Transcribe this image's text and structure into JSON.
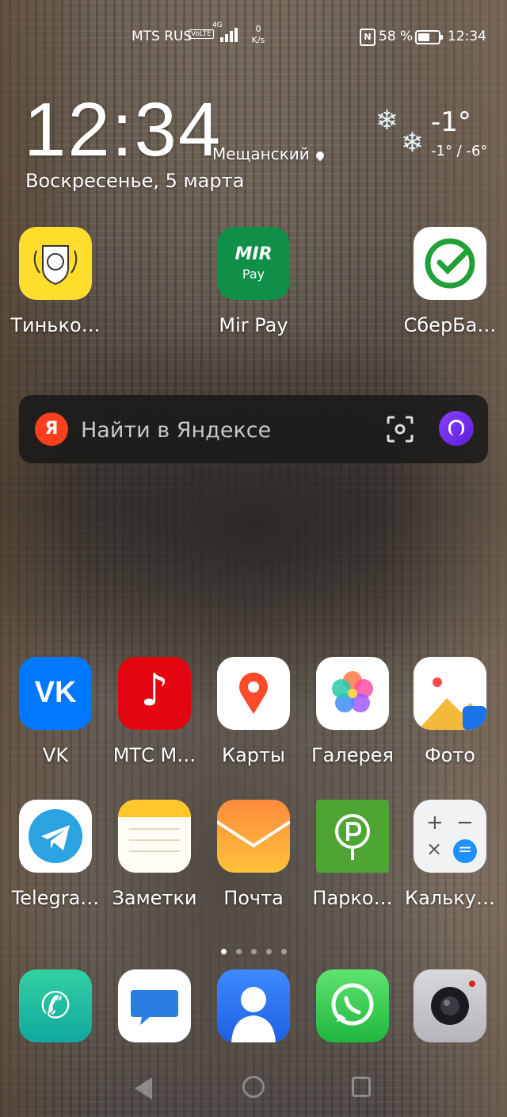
{
  "status_bar": {
    "carrier": "MTS RUS",
    "volte": "VoLTE",
    "network": "4G",
    "speed_value": "0",
    "speed_unit": "K/s",
    "nfc": "N",
    "battery_percent": "58 %",
    "battery_level": 0.58,
    "time": "12:34"
  },
  "clock_widget": {
    "time": "12:34",
    "location": "Мещанский",
    "date": "Воскресенье, 5 марта"
  },
  "weather": {
    "icon": "snowflake-icon",
    "temperature": "-1°",
    "range": "-1° / -6°"
  },
  "top_apps": [
    {
      "label": "Тинько…",
      "icon": "tinkoff-icon"
    },
    {
      "label": "Mir Pay",
      "icon": "mir-pay-icon"
    },
    {
      "label": "СберБа…",
      "icon": "sberbank-icon"
    }
  ],
  "search": {
    "logo": "Я",
    "placeholder": "Найти в Яндексе",
    "lens_icon": "camera-lens-icon",
    "assistant_icon": "alice-icon"
  },
  "mir_pay_tile": {
    "line1": "MIR",
    "line2": "Pay"
  },
  "apps_row1": [
    {
      "label": "VK",
      "icon": "vk-icon"
    },
    {
      "label": "МТС М…",
      "icon": "mts-music-icon"
    },
    {
      "label": "Карты",
      "icon": "maps-icon"
    },
    {
      "label": "Галерея",
      "icon": "gallery-icon"
    },
    {
      "label": "Фото",
      "icon": "photos-icon"
    }
  ],
  "apps_row2": [
    {
      "label": "Telegra…",
      "icon": "telegram-icon"
    },
    {
      "label": "Заметки",
      "icon": "notes-icon"
    },
    {
      "label": "Почта",
      "icon": "mail-icon"
    },
    {
      "label": "Парко…",
      "icon": "parking-icon"
    },
    {
      "label": "Кальку…",
      "icon": "calculator-icon"
    }
  ],
  "dock": [
    {
      "icon": "phone-icon"
    },
    {
      "icon": "messages-icon"
    },
    {
      "icon": "contacts-icon"
    },
    {
      "icon": "whatsapp-icon"
    },
    {
      "icon": "camera-icon"
    }
  ],
  "page_indicator": {
    "count": 5,
    "active": 0
  }
}
